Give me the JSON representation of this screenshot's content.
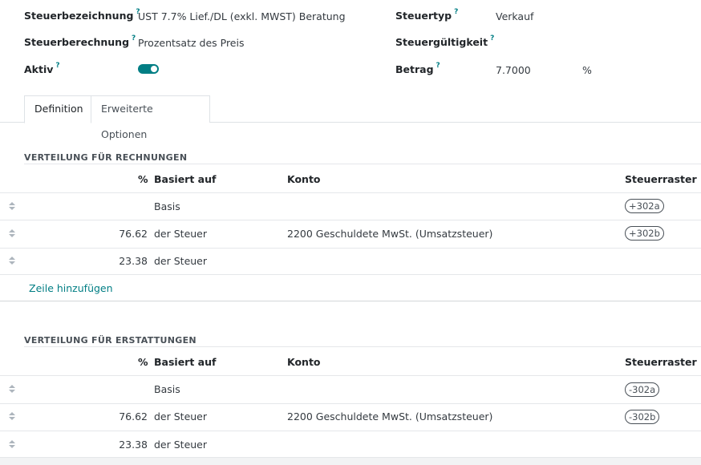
{
  "fields": {
    "tax_name_label": "Steuerbezeichnung",
    "tax_name_value": "UST 7.7% Lief./DL (exkl. MWST) Beratung",
    "tax_computation_label": "Steuerberechnung",
    "tax_computation_value": "Prozentsatz des Preis",
    "active_label": "Aktiv",
    "active_value": true,
    "tax_type_label": "Steuertyp",
    "tax_type_value": "Verkauf",
    "tax_scope_label": "Steuergültigkeit",
    "amount_label": "Betrag",
    "amount_value": "7.7000",
    "amount_unit": "%",
    "help_marker": "?"
  },
  "tabs": [
    {
      "label": "Definition",
      "active": true
    },
    {
      "label": "Erweiterte Optionen",
      "active": false
    }
  ],
  "invoice_section": {
    "title": "VERTEILUNG FÜR RECHNUNGEN",
    "columns": {
      "percent": "%",
      "based_on": "Basiert auf",
      "account": "Konto",
      "tax_grids": "Steuerraster"
    },
    "rows": [
      {
        "percent": "",
        "based_on": "Basis",
        "account": "",
        "tag": "+302a"
      },
      {
        "percent": "76.62",
        "based_on": "der Steuer",
        "account": "2200 Geschuldete MwSt. (Umsatzsteuer)",
        "tag": "+302b"
      },
      {
        "percent": "23.38",
        "based_on": "der Steuer",
        "account": "",
        "tag": ""
      }
    ],
    "add_line": "Zeile hinzufügen"
  },
  "refund_section": {
    "title": "VERTEILUNG FÜR ERSTATTUNGEN",
    "columns": {
      "percent": "%",
      "based_on": "Basiert auf",
      "account": "Konto",
      "tax_grids": "Steuerraster"
    },
    "rows": [
      {
        "percent": "",
        "based_on": "Basis",
        "account": "",
        "tag": "-302a"
      },
      {
        "percent": "76.62",
        "based_on": "der Steuer",
        "account": "2200 Geschuldete MwSt. (Umsatzsteuer)",
        "tag": "-302b"
      },
      {
        "percent": "23.38",
        "based_on": "der Steuer",
        "account": "",
        "tag": ""
      }
    ]
  },
  "colors": {
    "accent": "#017e84"
  }
}
